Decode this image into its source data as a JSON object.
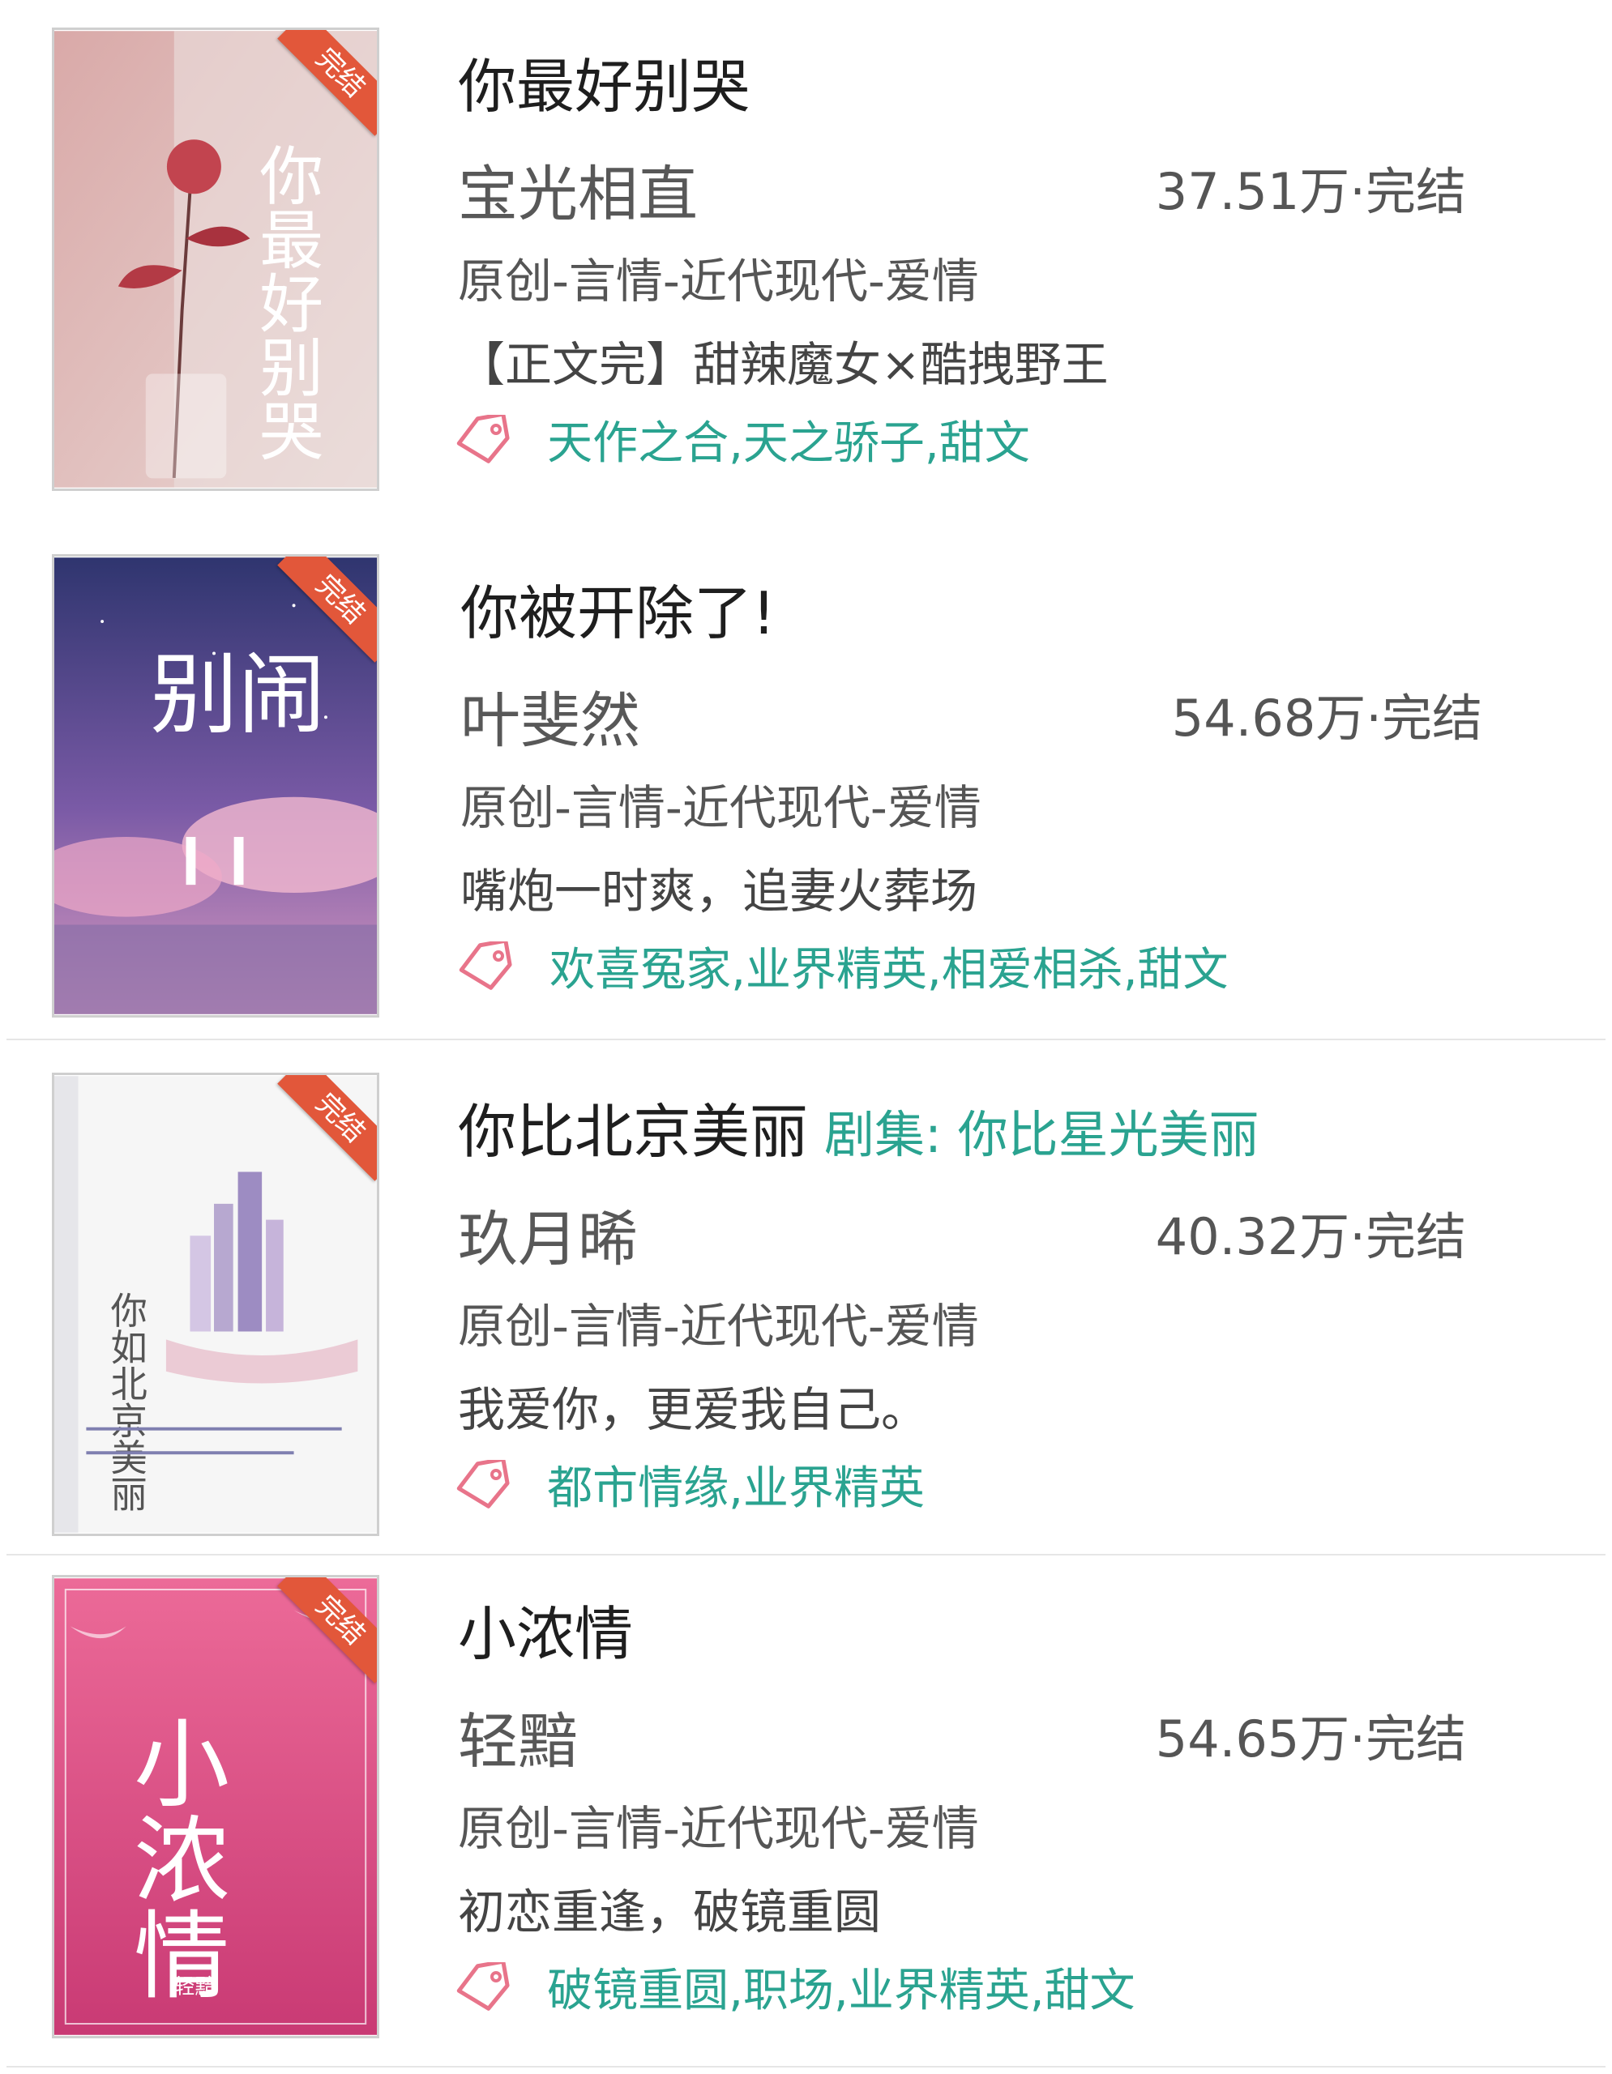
{
  "status_ribbon": "完结",
  "books": [
    {
      "title": "你最好别哭",
      "adaptation": "",
      "author": "宝光相直",
      "words": "37.51万",
      "status": "完结",
      "category": "原创-言情-近代现代-爱情",
      "intro": "【正文完】甜辣魔女×酷拽野王",
      "tags": "天作之合,天之骄子,甜文",
      "cover": {
        "colors": [
          "#e4c8c6",
          "#c79aa0"
        ],
        "art_text": "你最好别哭"
      }
    },
    {
      "title": "你被开除了!",
      "adaptation": "",
      "author": "叶斐然",
      "words": "54.68万",
      "status": "完结",
      "category": "原创-言情-近代现代-爱情",
      "intro": "嘴炮一时爽，追妻火葬场",
      "tags": "欢喜冤家,业界精英,相爱相杀,甜文",
      "cover": {
        "colors": [
          "#3a3f82",
          "#d59bc2"
        ],
        "art_text": "别闹"
      }
    },
    {
      "title": "你比北京美丽",
      "adaptation": "剧集: 你比星光美丽",
      "author": "玖月晞",
      "words": "40.32万",
      "status": "完结",
      "category": "原创-言情-近代现代-爱情",
      "intro": "我爱你，更爱我自己。",
      "tags": "都市情缘,业界精英",
      "cover": {
        "colors": [
          "#f8f8f8",
          "#c9b7d6"
        ],
        "art_text": "你如北京美丽"
      }
    },
    {
      "title": "小浓情",
      "adaptation": "",
      "author": "轻黯",
      "words": "54.65万",
      "status": "完结",
      "category": "原创-言情-近代现代-爱情",
      "intro": "初恋重逢，破镜重圆",
      "tags": "破镜重圆,职场,业界精英,甜文",
      "cover": {
        "colors": [
          "#e85a8e",
          "#c43a72"
        ],
        "art_text": "小浓情"
      }
    }
  ],
  "colors": {
    "accent": "#2aa390",
    "ribbon": "#e2573a",
    "tag_icon": "#e8748a"
  }
}
